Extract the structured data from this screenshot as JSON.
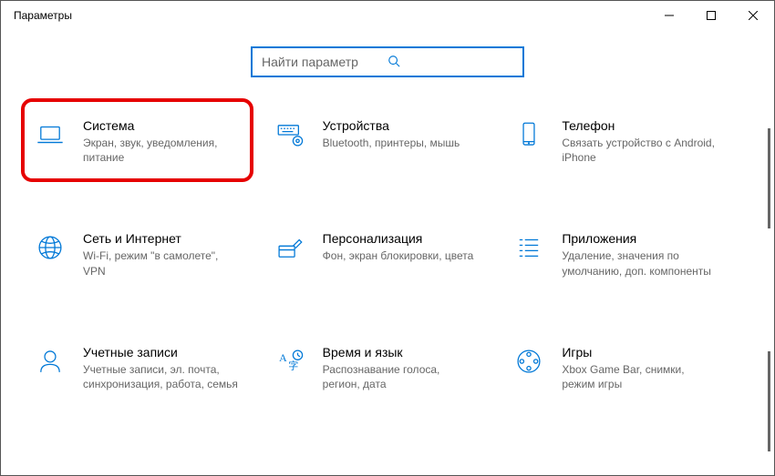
{
  "window_title": "Параметры",
  "search": {
    "placeholder": "Найти параметр"
  },
  "tiles": {
    "system": {
      "title": "Система",
      "desc": "Экран, звук, уведомления, питание"
    },
    "devices": {
      "title": "Устройства",
      "desc": "Bluetooth, принтеры, мышь"
    },
    "phone": {
      "title": "Телефон",
      "desc": "Связать устройство с Android, iPhone"
    },
    "network": {
      "title": "Сеть и Интернет",
      "desc": "Wi-Fi, режим \"в самолете\", VPN"
    },
    "personal": {
      "title": "Персонализация",
      "desc": "Фон, экран блокировки, цвета"
    },
    "apps": {
      "title": "Приложения",
      "desc": "Удаление, значения по умолчанию, доп. компоненты"
    },
    "accounts": {
      "title": "Учетные записи",
      "desc": "Учетные записи, эл. почта, синхронизация, работа, семья"
    },
    "time": {
      "title": "Время и язык",
      "desc": "Распознавание голоса, регион, дата"
    },
    "gaming": {
      "title": "Игры",
      "desc": "Xbox Game Bar, снимки, режим игры"
    }
  },
  "highlight": "system"
}
